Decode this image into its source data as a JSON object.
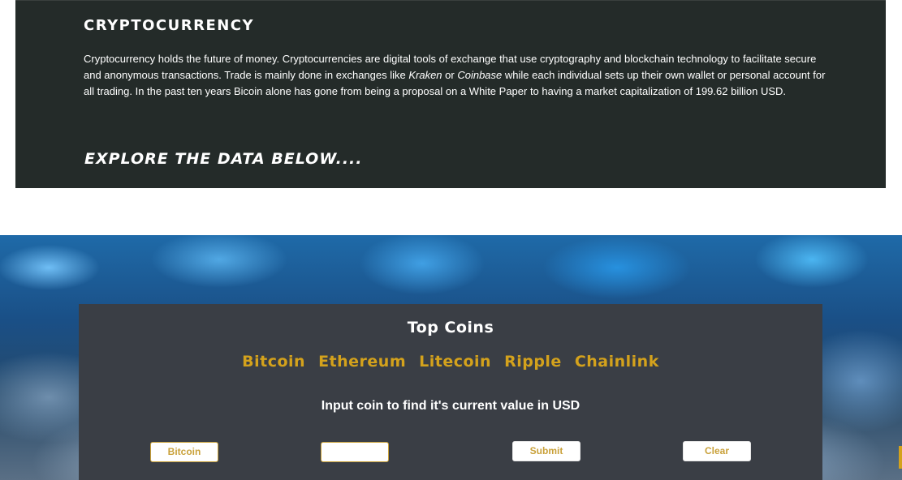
{
  "intro": {
    "title": "CRYPTOCURRENCY",
    "paragraph_part1": "Cryptocurrency holds the future of money. Cryptocurrencies are digital tools of exchange that use cryptography and blockchain technology to facilitate secure and anonymous transactions. Trade is mainly done in exchanges like ",
    "exchange1": "Kraken",
    "paragraph_part2": " or ",
    "exchange2": "Coinbase",
    "paragraph_part3": " while each individual sets up their own wallet or personal account for all trading. In the past ten years Bicoin alone has gone from being a proposal on a White Paper to having a market capitalization of 199.62 billion USD.",
    "explore": "EXPLORE THE DATA BELOW...."
  },
  "coins": {
    "title": "Top Coins",
    "links": [
      "Bitcoin",
      "Ethereum",
      "Litecoin",
      "Ripple",
      "Chainlink"
    ],
    "prompt": "Input coin to find it's current value in USD",
    "select_value": "Bitcoin",
    "input_value": "",
    "submit_label": "Submit",
    "clear_label": "Clear"
  },
  "colors": {
    "panel_dark": "#242b29",
    "coins_panel": "#3a3e45",
    "accent_gold": "#d4a21c"
  }
}
